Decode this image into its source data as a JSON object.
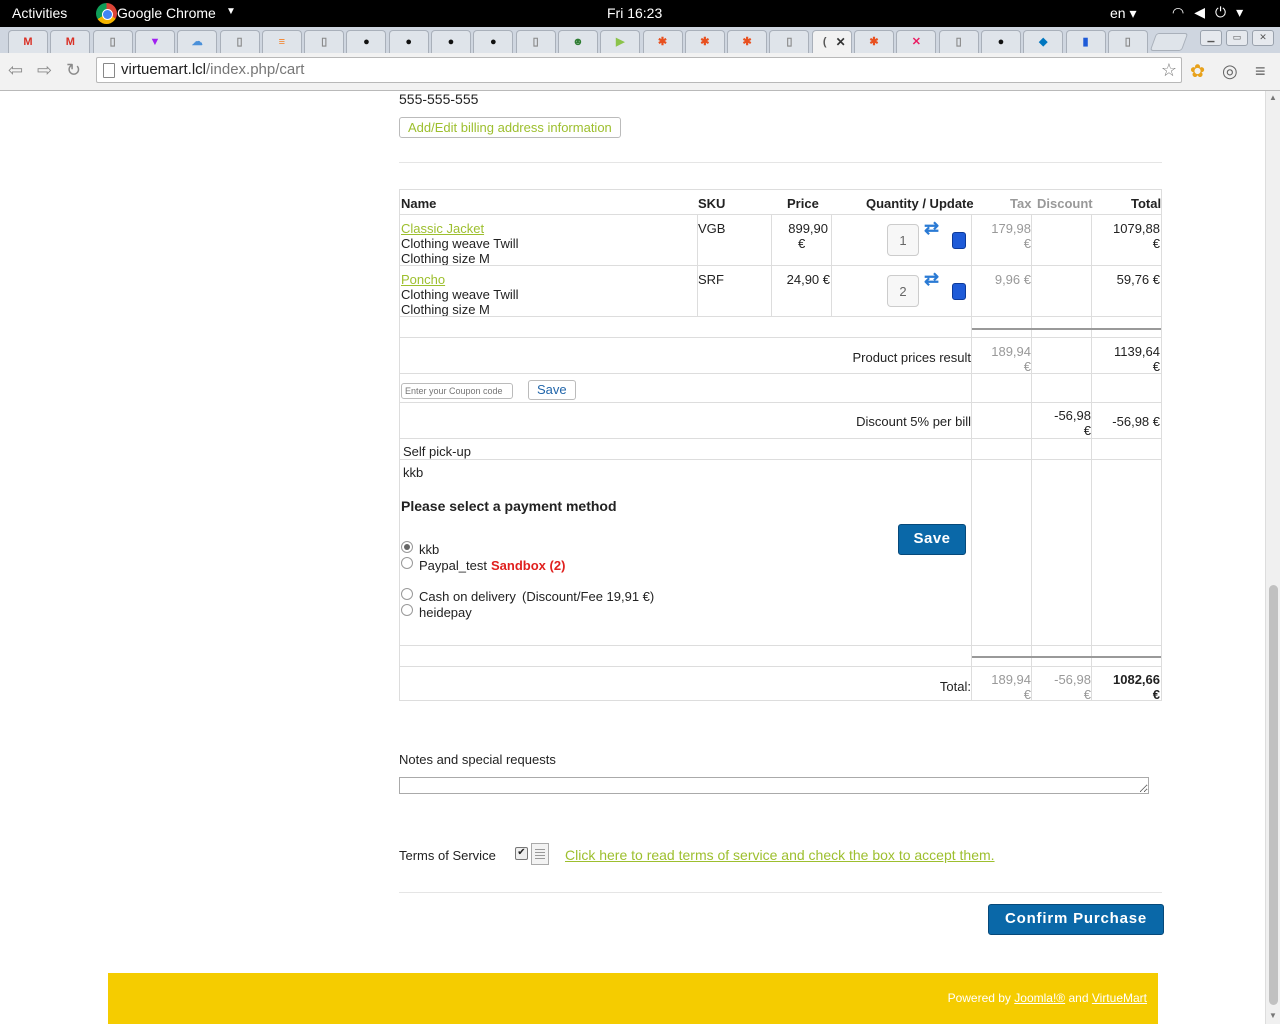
{
  "system": {
    "activities": "Activities",
    "app_name": "Google Chrome",
    "clock": "Fri 16:23",
    "language": "en"
  },
  "tabs": [
    {
      "icon": "gmail-icon",
      "glyph": "M",
      "color": "#d93025"
    },
    {
      "icon": "gmail-icon",
      "glyph": "M",
      "color": "#d93025"
    },
    {
      "icon": "page-icon",
      "glyph": "▯",
      "color": "#888888"
    },
    {
      "icon": "prism-icon",
      "glyph": "▼",
      "color": "#a020f0"
    },
    {
      "icon": "cloud-icon",
      "glyph": "☁",
      "color": "#4a90d9"
    },
    {
      "icon": "page-icon",
      "glyph": "▯",
      "color": "#888888"
    },
    {
      "icon": "stackoverflow-icon",
      "glyph": "≡",
      "color": "#f48024"
    },
    {
      "icon": "page-icon",
      "glyph": "▯",
      "color": "#888888"
    },
    {
      "icon": "github-icon",
      "glyph": "●",
      "color": "#111111"
    },
    {
      "icon": "github-icon",
      "glyph": "●",
      "color": "#111111"
    },
    {
      "icon": "github-icon",
      "glyph": "●",
      "color": "#111111"
    },
    {
      "icon": "github-icon",
      "glyph": "●",
      "color": "#111111"
    },
    {
      "icon": "page-icon",
      "glyph": "▯",
      "color": "#888888"
    },
    {
      "icon": "avatar-icon",
      "glyph": "☻",
      "color": "#2e7d32"
    },
    {
      "icon": "play-icon",
      "glyph": "▶",
      "color": "#8bc34a"
    },
    {
      "icon": "joomla-icon",
      "glyph": "✱",
      "color": "#e8501f"
    },
    {
      "icon": "joomla-icon",
      "glyph": "✱",
      "color": "#e8501f"
    },
    {
      "icon": "joomla-icon",
      "glyph": "✱",
      "color": "#e8501f"
    },
    {
      "icon": "page-icon",
      "glyph": "▯",
      "color": "#888888"
    },
    {
      "icon": "loading-icon",
      "glyph": "(",
      "color": "#555555",
      "active": true
    },
    {
      "icon": "joomla-icon",
      "glyph": "✱",
      "color": "#e8501f"
    },
    {
      "icon": "xmind-icon",
      "glyph": "✕",
      "color": "#e91e63"
    },
    {
      "icon": "page-icon",
      "glyph": "▯",
      "color": "#888888"
    },
    {
      "icon": "github-icon",
      "glyph": "●",
      "color": "#111111"
    },
    {
      "icon": "drupal-icon",
      "glyph": "◆",
      "color": "#0077c0"
    },
    {
      "icon": "database-icon",
      "glyph": "▮",
      "color": "#1e5bd8"
    },
    {
      "icon": "page-icon",
      "glyph": "▯",
      "color": "#888888"
    }
  ],
  "address_bar": {
    "host": "virtuemart.lcl",
    "path": "/index.php/cart"
  },
  "billing": {
    "phone": "555-555-555",
    "edit_button": "Add/Edit billing address information"
  },
  "cart": {
    "headers": {
      "name": "Name",
      "sku": "SKU",
      "price": "Price",
      "qty": "Quantity / Update",
      "tax": "Tax",
      "discount": "Discount",
      "total": "Total"
    },
    "items": [
      {
        "name": "Classic Jacket",
        "attr1": "Clothing weave Twill",
        "attr2": "Clothing size M",
        "sku": "VGB",
        "price_l1": "899,90",
        "price_l2": "€",
        "qty": "1",
        "tax_l1": "179,98",
        "tax_l2": "€",
        "total_l1": "1079,88",
        "total_l2": "€"
      },
      {
        "name": "Poncho",
        "attr1": "Clothing weave Twill",
        "attr2": "Clothing size M",
        "sku": "SRF",
        "price_l1": "24,90 €",
        "price_l2": "",
        "qty": "2",
        "tax_l1": "9,96 €",
        "tax_l2": "",
        "total_l1": "59,76 €",
        "total_l2": ""
      }
    ],
    "product_prices": {
      "label": "Product prices result",
      "tax_l1": "189,94",
      "tax_l2": "€",
      "total_l1": "1139,64",
      "total_l2": "€"
    },
    "coupon": {
      "placeholder": "Enter your Coupon code",
      "save": "Save"
    },
    "discount_rule": {
      "label": "Discount 5% per bill",
      "discount_l1": "-56,98",
      "discount_l2": "€",
      "total": "-56,98 €"
    },
    "shipment": {
      "name": "Self pick-up"
    },
    "payment": {
      "selected": "kkb",
      "title": "Please select a payment method",
      "save": "Save",
      "options": [
        {
          "label": "kkb",
          "note": "",
          "checked": true
        },
        {
          "label": "Paypal_test",
          "note": "Sandbox (2)",
          "checked": false
        },
        {
          "label": "Cash on delivery",
          "note": "(Discount/Fee 19,91 €)",
          "checked": false
        },
        {
          "label": "heidepay",
          "note": "",
          "checked": false
        }
      ]
    },
    "grand_total": {
      "label": "Total:",
      "tax_l1": "189,94",
      "tax_l2": "€",
      "discount_l1": "-56,98",
      "discount_l2": "€",
      "total_l1": "1082,66",
      "total_l2": "€"
    }
  },
  "notes": {
    "label": "Notes and special requests",
    "value": ""
  },
  "tos": {
    "label": "Terms of Service",
    "link": "Click here to read terms of service and check the box to accept them.",
    "checked": true
  },
  "confirm_button": "Confirm Purchase",
  "footer": {
    "prefix": "Powered by",
    "joomla": "Joomla!®",
    "and": "and",
    "virtuemart": "VirtueMart",
    "color": "#f5cc00"
  }
}
